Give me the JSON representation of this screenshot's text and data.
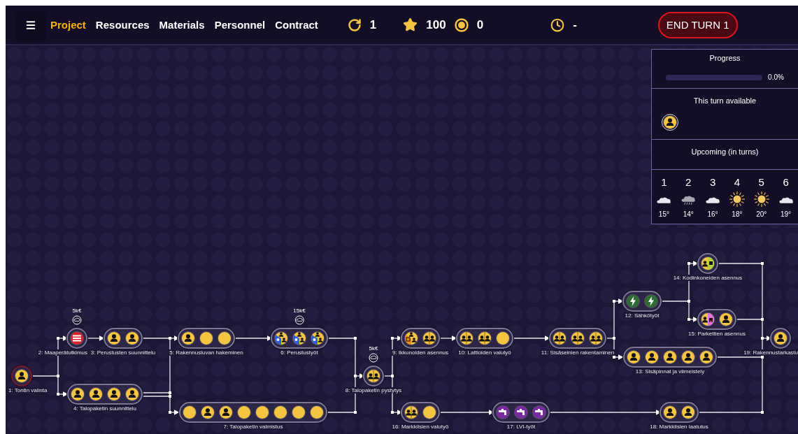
{
  "nav": [
    {
      "label": "Project",
      "selected": true
    },
    {
      "label": "Resources",
      "selected": false
    },
    {
      "label": "Materials",
      "selected": false
    },
    {
      "label": "Personnel",
      "selected": false
    },
    {
      "label": "Contract",
      "selected": false
    }
  ],
  "stats": [
    {
      "kind": "turn",
      "value": "1"
    },
    {
      "kind": "stars",
      "value": "100"
    },
    {
      "kind": "coins",
      "value": "0"
    },
    {
      "kind": "time",
      "value": "-"
    }
  ],
  "end_turn": "END TURN 1",
  "panel": {
    "progress": {
      "title": "Progress",
      "level": 0,
      "reading": "0.0%"
    },
    "available": {
      "title": "This turn available",
      "items": [
        {
          "kind": "worker"
        }
      ]
    },
    "upcoming": {
      "title": "Upcoming (in turns)",
      "forecast": [
        {
          "turn": "1",
          "kind": "cloudy",
          "temp": "15°"
        },
        {
          "turn": "2",
          "kind": "rain",
          "temp": "14°"
        },
        {
          "turn": "3",
          "kind": "cloudy",
          "temp": "16°"
        },
        {
          "turn": "4",
          "kind": "sunny",
          "temp": "18°"
        },
        {
          "turn": "5",
          "kind": "sunny",
          "temp": "20°"
        },
        {
          "turn": "6",
          "kind": "cloudy",
          "temp": "19°"
        }
      ]
    }
  },
  "tasks": [
    {
      "label": "1: Tontin valinta",
      "active": true,
      "slots": [
        {
          "kind": "worker"
        }
      ]
    },
    {
      "label": "2: Maaperätutkimus",
      "active": false,
      "cost": "5k€",
      "slots": [
        {
          "kind": "red"
        }
      ]
    },
    {
      "label": "3: Perustusten suunnittelu",
      "active": false,
      "slots": [
        {
          "kind": "worker"
        },
        {
          "kind": "worker"
        }
      ]
    },
    {
      "label": "4: Talopaketin suunnittelu",
      "active": false,
      "slots": [
        {
          "kind": "worker"
        },
        {
          "kind": "worker"
        },
        {
          "kind": "worker"
        },
        {
          "kind": "worker"
        }
      ]
    },
    {
      "label": "5: Rakennusluvan hakeminen",
      "active": false,
      "slots": [
        {
          "kind": "worker"
        },
        {
          "kind": "empty"
        },
        {
          "kind": "empty"
        }
      ]
    },
    {
      "label": "6: Perustustyöt",
      "active": false,
      "cost": "15k€",
      "slots": [
        {
          "kind": "blue"
        },
        {
          "kind": "blue"
        },
        {
          "kind": "blue"
        }
      ]
    },
    {
      "label": "7: Talopaketin valmistus",
      "active": false,
      "slots": [
        {
          "kind": "empty"
        },
        {
          "kind": "worker"
        },
        {
          "kind": "worker"
        },
        {
          "kind": "empty"
        },
        {
          "kind": "empty"
        },
        {
          "kind": "empty"
        },
        {
          "kind": "empty"
        },
        {
          "kind": "empty"
        }
      ]
    },
    {
      "label": "8: Talopaketin pystytys",
      "active": false,
      "cost": "5k€",
      "slots": [
        {
          "kind": "pair"
        }
      ]
    },
    {
      "label": "9: Ikkunoiden asennus",
      "active": false,
      "slots": [
        {
          "kind": "orange"
        },
        {
          "kind": "pair"
        }
      ]
    },
    {
      "label": "10: Lattioiden valutyö",
      "active": false,
      "slots": [
        {
          "kind": "pair"
        },
        {
          "kind": "pair"
        },
        {
          "kind": "empty"
        }
      ]
    },
    {
      "label": "11: Sisäseinien rakentaminen",
      "active": false,
      "slots": [
        {
          "kind": "pair"
        },
        {
          "kind": "pair"
        },
        {
          "kind": "pair"
        }
      ]
    },
    {
      "label": "12: Sähkötyöt",
      "active": false,
      "slots": [
        {
          "kind": "green"
        },
        {
          "kind": "green"
        }
      ]
    },
    {
      "label": "13: Sisäpinnat ja viimeistely",
      "active": false,
      "slots": [
        {
          "kind": "worker"
        },
        {
          "kind": "worker"
        },
        {
          "kind": "worker"
        },
        {
          "kind": "worker"
        },
        {
          "kind": "worker"
        }
      ]
    },
    {
      "label": "14: Kodinkoneiden asennus",
      "active": false,
      "slots": [
        {
          "kind": "lime"
        }
      ]
    },
    {
      "label": "15: Parkettien asennus",
      "active": false,
      "slots": [
        {
          "kind": "pink"
        },
        {
          "kind": "worker"
        }
      ]
    },
    {
      "label": "16: Markkiisien valutyö",
      "active": false,
      "slots": [
        {
          "kind": "pair"
        },
        {
          "kind": "empty"
        }
      ]
    },
    {
      "label": "17: LVI-työt",
      "active": false,
      "slots": [
        {
          "kind": "purple"
        },
        {
          "kind": "purple"
        },
        {
          "kind": "purple"
        }
      ]
    },
    {
      "label": "18: Markkiisien laatutus",
      "active": false,
      "slots": [
        {
          "kind": "worker"
        },
        {
          "kind": "worker"
        }
      ]
    },
    {
      "label": "19: Rakennustarkastu",
      "active": false,
      "slots": [
        {
          "kind": "worker"
        }
      ]
    }
  ]
}
